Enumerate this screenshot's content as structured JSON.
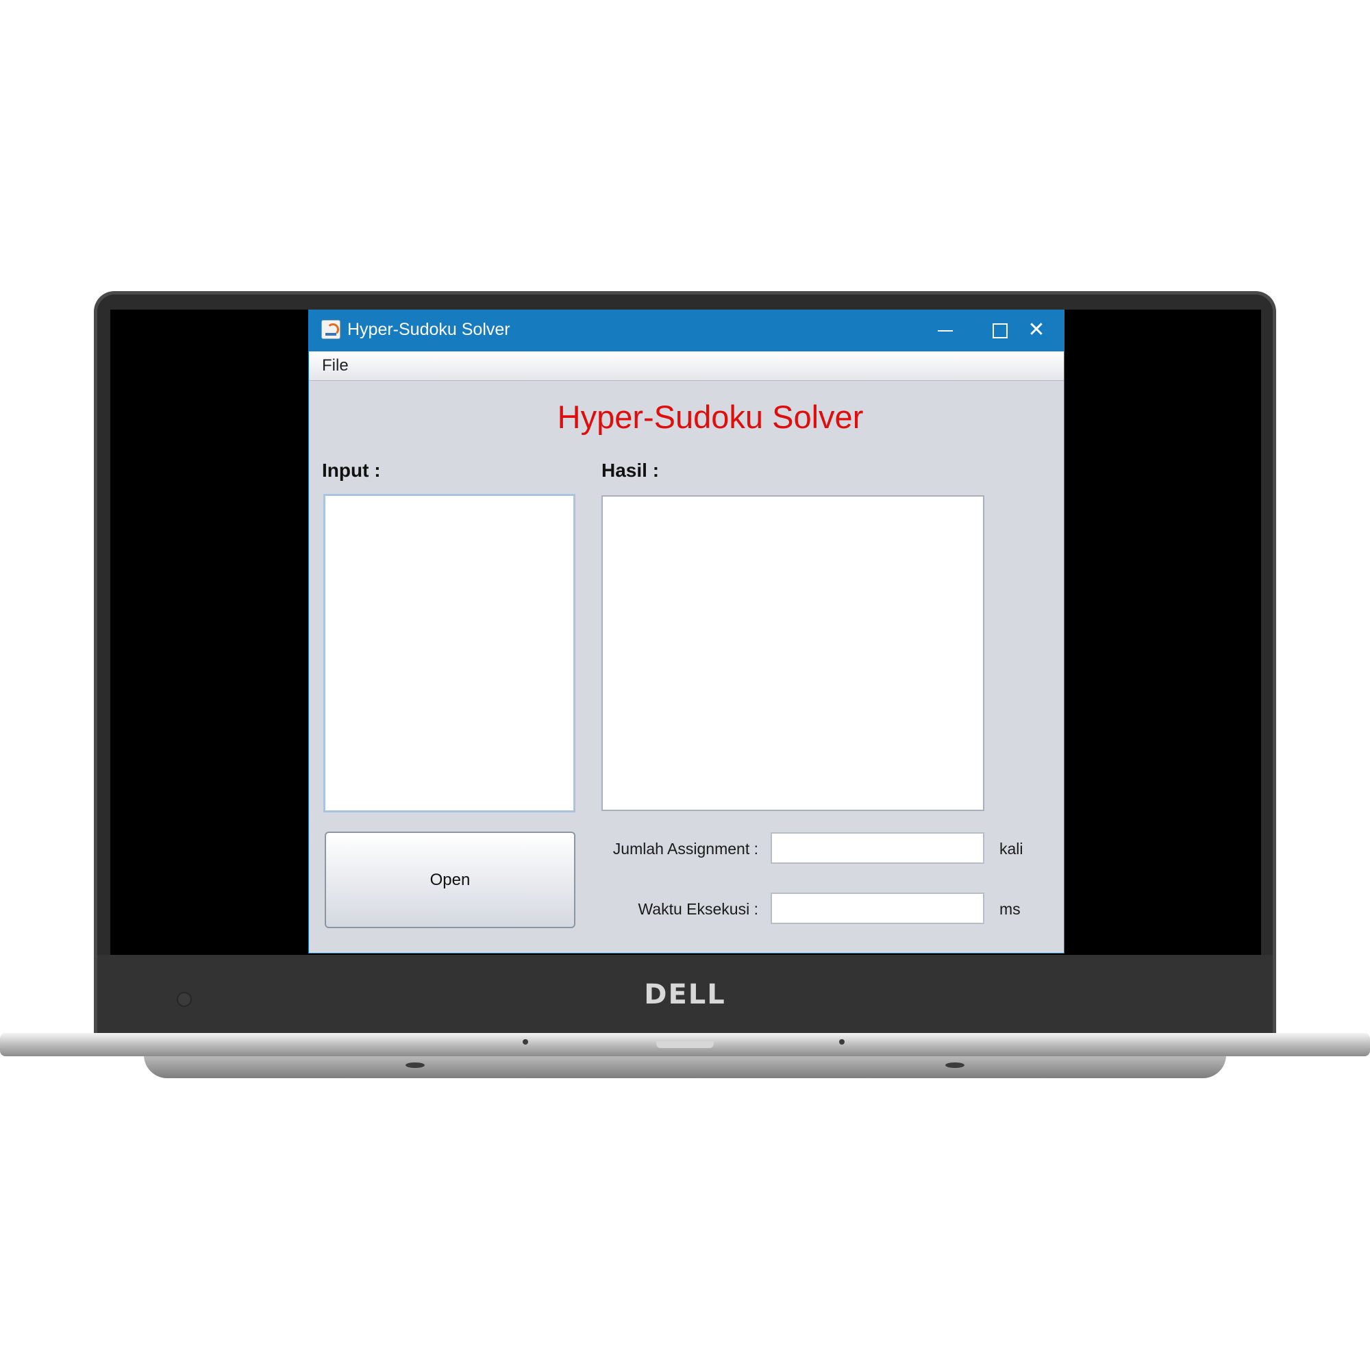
{
  "device": {
    "brand": "DELL"
  },
  "window": {
    "title": "Hyper-Sudoku Solver",
    "controls": {
      "minimize": "—",
      "maximize": "☐",
      "close": "✕"
    }
  },
  "menu": {
    "file": "File"
  },
  "main": {
    "heading": "Hyper-Sudoku Solver",
    "heading_color": "#e00d0d",
    "input_label": "Input :",
    "result_label": "Hasil :",
    "input_text": "",
    "result_text": "",
    "open_button": "Open",
    "assignment": {
      "label": "Jumlah Assignment :",
      "value": "",
      "unit": "kali"
    },
    "execution_time": {
      "label": "Waktu Eksekusi :",
      "value": "",
      "unit": "ms"
    }
  },
  "icons": {
    "app": "java-coffee-icon",
    "webcam": "webcam-icon"
  },
  "colors": {
    "titlebar": "#167bbf",
    "window_bg": "#d6d9e0",
    "accent_border": "#1c7ec4"
  }
}
